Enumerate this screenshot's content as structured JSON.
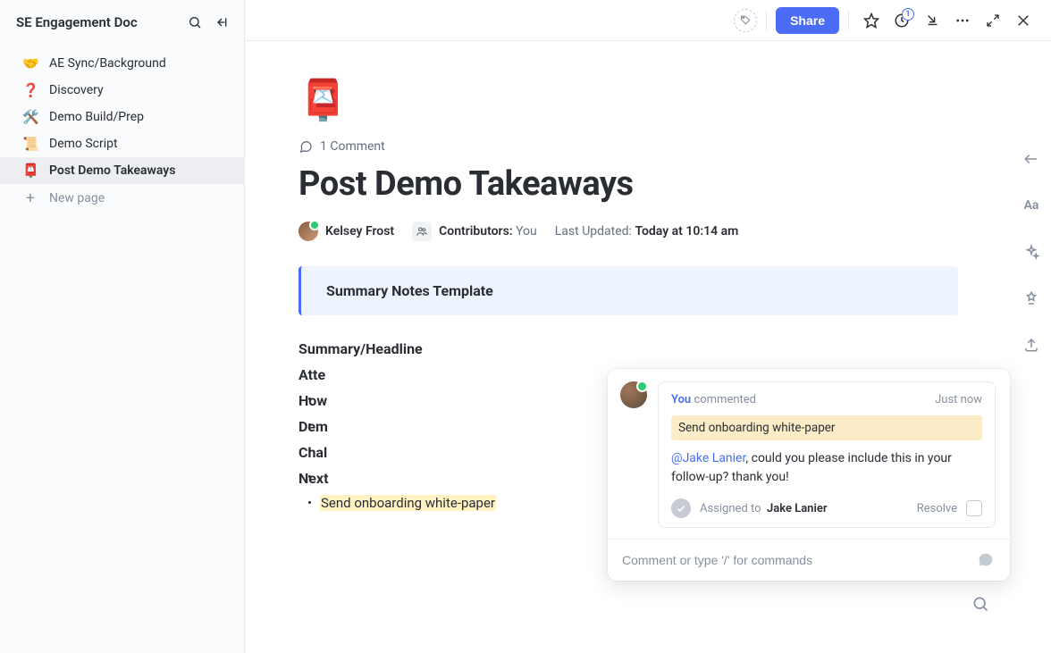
{
  "sidebar": {
    "title": "SE Engagement Doc",
    "items": [
      {
        "emoji": "🤝",
        "label": "AE Sync/Background"
      },
      {
        "emoji": "❓",
        "label": "Discovery"
      },
      {
        "emoji": "🛠️",
        "label": "Demo Build/Prep"
      },
      {
        "emoji": "📜",
        "label": "Demo Script"
      },
      {
        "emoji": "📮",
        "label": "Post Demo Takeaways"
      }
    ],
    "new_page": "New page"
  },
  "topbar": {
    "share": "Share",
    "bell_count": "1"
  },
  "doc": {
    "hero_emoji": "📮",
    "comment_count": "1 Comment",
    "title": "Post Demo Takeaways",
    "author": "Kelsey Frost",
    "contributors_label": "Contributors:",
    "contributors_value": "You",
    "last_updated_label": "Last Updated:",
    "last_updated_value": "Today at 10:14 am",
    "callout": "Summary Notes Template",
    "sections": [
      "Summary/Headline",
      "Atte",
      "How",
      "Dem",
      "Chal",
      "Next"
    ],
    "highlighted_item": "Send onboarding white-paper"
  },
  "comment": {
    "you": "You",
    "verb": "commented",
    "time": "Just now",
    "quote": "Send onboarding white-paper",
    "mention": "@Jake Lanier",
    "message_rest": ", could you please include this in your follow-up? thank you!",
    "assigned_label": "Assigned to",
    "assigned_name": "Jake Lanier",
    "resolve": "Resolve",
    "reply_placeholder": "Comment or type '/' for commands"
  },
  "rail": {
    "aa": "Aa"
  }
}
